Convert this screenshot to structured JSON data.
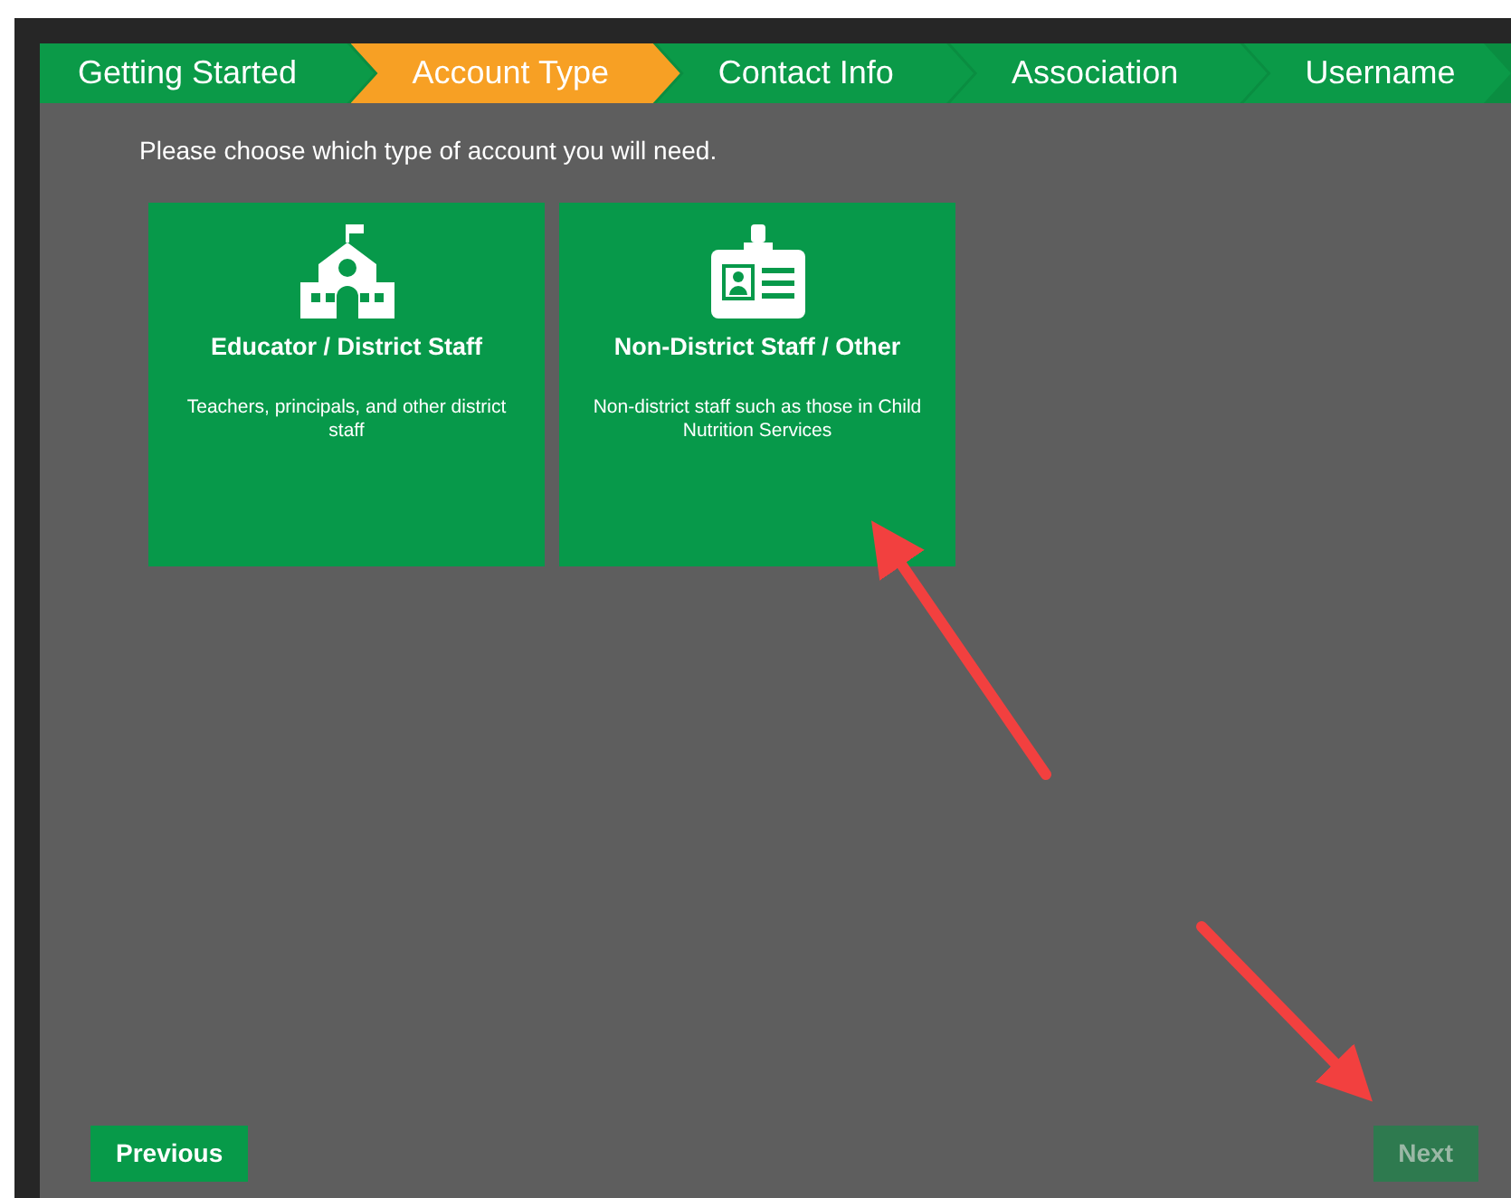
{
  "steps": [
    {
      "label": "Getting Started",
      "selected": false
    },
    {
      "label": "Account Type",
      "selected": true
    },
    {
      "label": "Contact Info",
      "selected": false
    },
    {
      "label": "Association",
      "selected": false
    },
    {
      "label": "Username",
      "selected": false
    }
  ],
  "prompt": "Please choose which type of account you will need.",
  "account_types": [
    {
      "kind": "school",
      "title": "Educator / District Staff",
      "description": "Teachers, principals, and other district staff"
    },
    {
      "kind": "badge",
      "title": "Non-District Staff / Other",
      "description": "Non-district staff such as those in Child Nutrition Services"
    }
  ],
  "buttons": [
    {
      "label": "Previous",
      "disabled": false
    },
    {
      "label": "Next",
      "disabled": true
    }
  ]
}
